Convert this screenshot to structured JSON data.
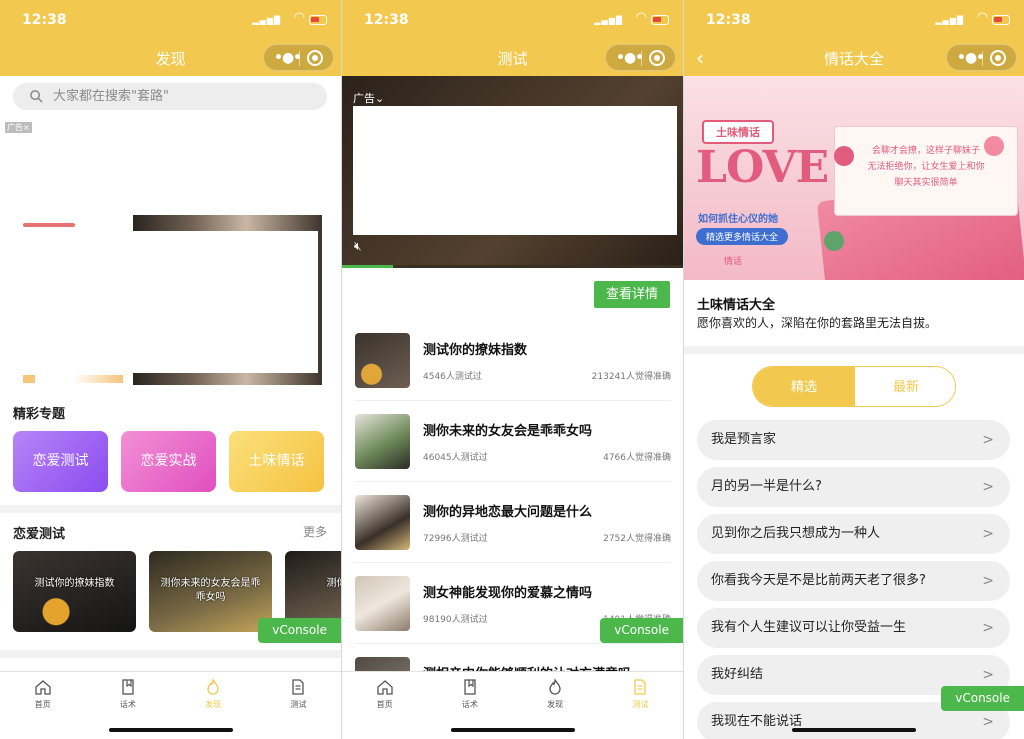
{
  "status": {
    "time": "12:38"
  },
  "discover": {
    "title": "发现",
    "search_placeholder": "大家都在搜索\"套路\"",
    "ad_label": "广告×",
    "topics_title": "精彩专题",
    "topics": [
      "恋爱测试",
      "恋爱实战",
      "土味情话"
    ],
    "love_test_title": "恋爱测试",
    "more": "更多",
    "cards": [
      "测试你的撩妹指数",
      "测你未来的女友会是乖乖女吗",
      "测你的异"
    ]
  },
  "test": {
    "title": "测试",
    "ad_label": "广告⌄",
    "mute_icon": "mute-icon",
    "progress": 0.15,
    "detail_button": "查看详情",
    "items": [
      {
        "title": "测试你的撩妹指数",
        "count": "4546人测试过",
        "accuracy": "213241人觉得准确"
      },
      {
        "title": "测你未来的女友会是乖乖女吗",
        "count": "46045人测试过",
        "accuracy": "4766人觉得准确"
      },
      {
        "title": "测你的异地恋最大问题是什么",
        "count": "72996人测试过",
        "accuracy": "2752人觉得准确"
      },
      {
        "title": "测女神能发现你的爱慕之情吗",
        "count": "98190人测试过",
        "accuracy": "1401人觉得准确"
      },
      {
        "title": "测相亲中你能够顺利的让对方满意吗",
        "count": "",
        "accuracy": ""
      }
    ]
  },
  "pickup": {
    "title": "情话大全",
    "hero": {
      "badge": "土味情话",
      "love": "LOVE",
      "line1": "如何抓住心仪的她",
      "tag": "精选更多情话大全",
      "foot": "情话",
      "note": [
        "会聊才会撩，这样子聊妹子",
        "无法拒绝你，让女生爱上和你",
        "聊天其实很简单"
      ]
    },
    "intro_title": "土味情话大全",
    "intro_desc": "愿你喜欢的人，深陷在你的套路里无法自拔。",
    "segments": [
      "精选",
      "最新"
    ],
    "phrases": [
      "我是预言家",
      "月的另一半是什么?",
      "见到你之后我只想成为一种人",
      "你看我今天是不是比前两天老了很多?",
      "我有个人生建议可以让你受益一生",
      "我好纠结",
      "我现在不能说话"
    ]
  },
  "tabs": {
    "p1": [
      "首页",
      "话术",
      "发现",
      "测试"
    ],
    "p2": [
      "首页",
      "话术",
      "发现",
      "测试"
    ]
  },
  "vconsole": "vConsole",
  "colors": {
    "brand": "#f2c94e",
    "green": "#4cb84c"
  }
}
